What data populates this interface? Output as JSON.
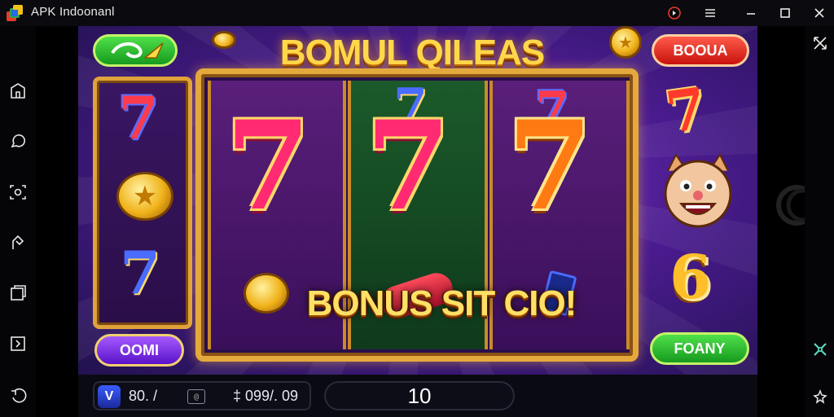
{
  "window": {
    "title": "APK Indoonanl"
  },
  "titlebar_icons": [
    "record-icon",
    "menu-icon",
    "minimize-icon",
    "maximize-icon",
    "close-icon"
  ],
  "left_toolbar": [
    "home-icon",
    "chat-icon",
    "screenshot-icon",
    "shake-icon",
    "multi-window-icon",
    "macro-icon",
    "back-icon"
  ],
  "right_toolbar": [
    "fullscreen-icon",
    "gamepad-icon",
    "settings-icon"
  ],
  "game": {
    "headline": "BOMUL QILEAS",
    "top_right_button": "BOOUA",
    "bonus_banner": "BONUS SIT CIO!",
    "left_bottom_button": "OOMI",
    "right_bottom_button": "FOANY",
    "reel_symbols": [
      "7",
      "7",
      "7"
    ],
    "side_symbols": {
      "seven": "7",
      "six": "6"
    }
  },
  "bottom_bar": {
    "balance_prefix": "V",
    "balance_value": "80. /",
    "balance_mid_label": "@",
    "balance_percent": "‡ 099/. 09",
    "bet_value": "10"
  },
  "colors": {
    "headline": "#ffd84a",
    "red_button": "#e0261c",
    "green_button": "#2fc12e",
    "purple_button": "#7c2fe6",
    "frame_gold": "#e4a93c"
  }
}
